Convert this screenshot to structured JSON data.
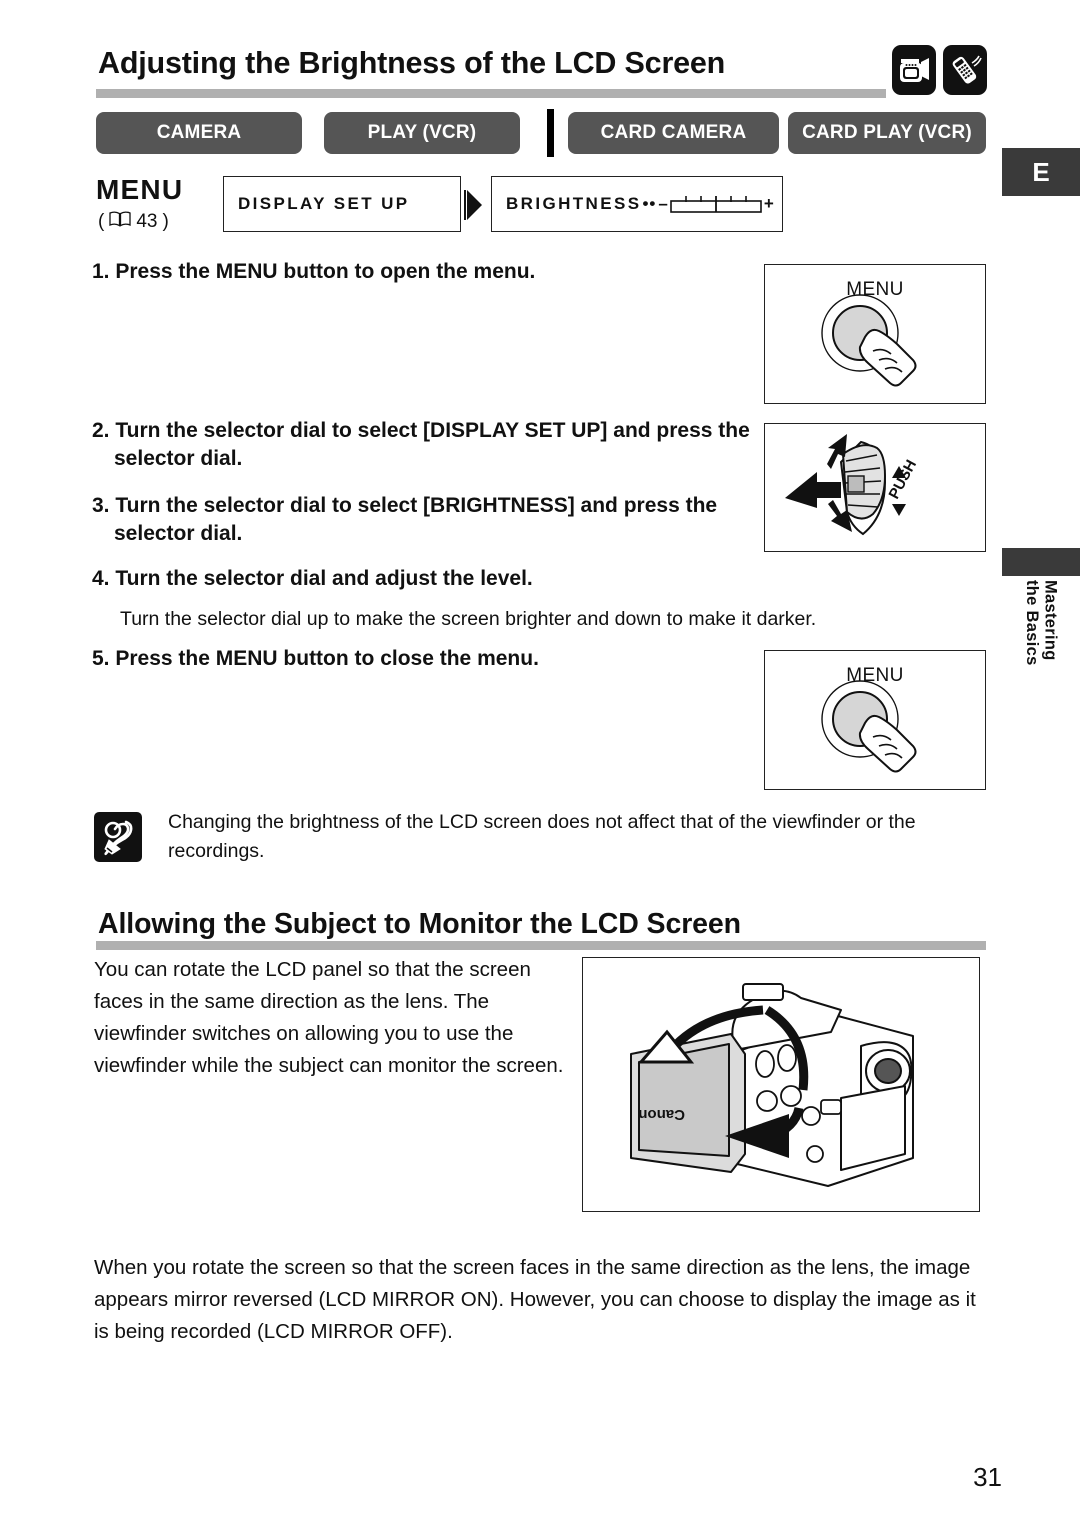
{
  "header": {
    "title": "Adjusting the Brightness of the LCD Screen",
    "icons": [
      "camcorder-icon",
      "remote-control-icon"
    ]
  },
  "mode_tabs": [
    {
      "label": "CAMERA"
    },
    {
      "label": "PLAY (VCR)"
    },
    {
      "label": "CARD CAMERA"
    },
    {
      "label": "CARD PLAY (VCR)"
    }
  ],
  "edition_badge": "E",
  "side_tab": {
    "text": "Mastering\nthe Basics"
  },
  "menu_path": {
    "menu_word": "MENU",
    "page_ref": "43",
    "book_icon": "book-icon",
    "first_item": "DISPLAY SET UP",
    "second_item": "BRIGHTNESS",
    "dots": "••",
    "minus": "–",
    "plus": "+",
    "arrow": "triangle-right-icon"
  },
  "steps": [
    {
      "num": "1.",
      "text": "Press the MENU button to open the menu."
    },
    {
      "num": "2.",
      "text": "Turn the selector dial to select [DISPLAY SET UP] and press the selector dial."
    },
    {
      "num": "3.",
      "text": "Turn the selector dial to select [BRIGHTNESS] and press the selector dial."
    },
    {
      "num": "4.",
      "text": "Turn the selector dial and adjust the level."
    },
    {
      "num": "5.",
      "text": "Press the MENU button to close the menu."
    }
  ],
  "step4_note": "Turn the selector dial up to make the screen brighter and down to make it darker.",
  "illustrations": {
    "menu_button_label": "MENU",
    "dial_push_label": "PUSH",
    "camcorder_brand": "Canon"
  },
  "note": {
    "icon": "note-pencil-icon",
    "text": "Changing the brightness of the LCD screen does not affect that of the viewfinder or the recordings."
  },
  "section2": {
    "title": "Allowing the Subject to Monitor the LCD Screen",
    "left_text": "You can rotate the LCD panel so that the screen faces in the same direction as the lens. The viewfinder switches on allowing you to use the viewfinder while the subject can monitor the screen.",
    "bottom_text": "When you rotate the screen so that the screen faces in the same direction as the lens, the image appears mirror reversed (LCD MIRROR ON). However, you can choose to display the image as it is being recorded (LCD MIRROR OFF)."
  },
  "page_number": "31",
  "colors": {
    "tab_bg": "#555555",
    "rule": "#b0b0b0",
    "badge_bg": "#3a3a3a",
    "ink": "#111111"
  }
}
